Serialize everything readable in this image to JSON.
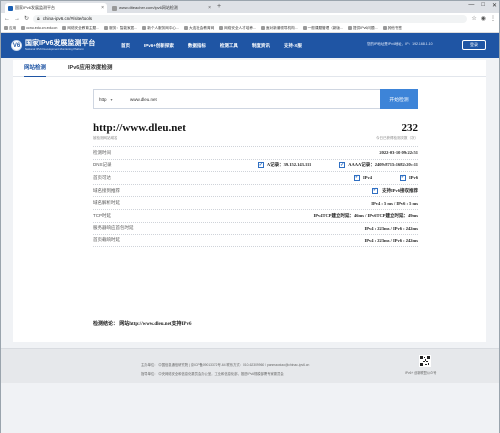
{
  "browser": {
    "tabs": [
      {
        "title": "国家IPv6发展监测平台",
        "active": true
      },
      {
        "title": "www.dlteacher.com/ipv6网站检测",
        "active": false
      }
    ],
    "new_tab": "+",
    "window_controls": [
      "—",
      "□",
      "✕"
    ],
    "url": "china-ipv6.cn/#/site/tools",
    "bookmarks": [
      "应用",
      "ccnu.edu.cn.edu.cn",
      "网络安全教育主题...",
      "服务：智能家居...",
      "新个人服务网中心...",
      "大连社会教育网",
      "网络安全人才培养...",
      "面对新潮领导机构...",
      "一般课题管理（新版...",
      "提供IPv6问题...",
      "其他书签"
    ]
  },
  "site": {
    "logo_mark": "V6",
    "name": "国家IPv6发展监测平台",
    "name_en": "National IPv6 Development Monitoring Platform",
    "nav": [
      "首页",
      "IPv6+创新探索",
      "数据指标",
      "检测工具",
      "制度资讯",
      "支持-X服"
    ],
    "ip_info": "您的IP地址是IPv4地址，IP：192.168.1.10",
    "login": "登录"
  },
  "tool": {
    "tabs": [
      "网站检测",
      "IPv6应用浓度检测"
    ],
    "protocol": "http",
    "domain": "www.dleu.net",
    "button": "开始检测"
  },
  "result": {
    "site": "http://www.dleu.net",
    "site_caption": "被检测网站域名",
    "score": "232",
    "score_caption": "今日已获得检测次数（次）",
    "rows": [
      {
        "label": "检测时间",
        "value": "2022-03-10 09:22:51"
      },
      {
        "label": "DNS记录",
        "a": "A记录：39.152.143.111",
        "aaaa": "AAAA记录：2409:8715:1682:20::11"
      },
      {
        "label": "首页可达",
        "v4": "IPv4",
        "v6": "IPv6"
      },
      {
        "label": "域名接到推荐",
        "value": "支持IPv6接収推荐"
      },
      {
        "label": "域名解析时延",
        "value": "IPv4 : 5 ms / IPv6 : 5 ms"
      },
      {
        "label": "TCP时延",
        "value": "IPv4TCP建立时延：46ms / IPv6TCP建立时延：49ms"
      },
      {
        "label": "服务器响应首包时延",
        "value": "IPv4 : 223ms / IPv6 : 242ms"
      },
      {
        "label": "首页载响时延",
        "value": "IPv4 : 223ms / IPv6 : 242ms"
      }
    ],
    "conclusion": "检测结论： 网站http://www.dleu.net支持IPv6"
  },
  "footer": {
    "line1": "主办单位： 中国信息通信研究院  |  京ICP备09013372号-64 联系方式：010-62309960 / panmaoxiao@chinac-ipv6.cn",
    "line2": "指导单位： 中央网络安全和信息化委员会办公室，工业和信息化部，推进IPv6规模部署专家委员会",
    "qr_caption": "IPv6+ 创新联盟公众号"
  },
  "colors": {
    "brand_blue": "#1f55a4",
    "button_blue": "#3d84d8"
  }
}
